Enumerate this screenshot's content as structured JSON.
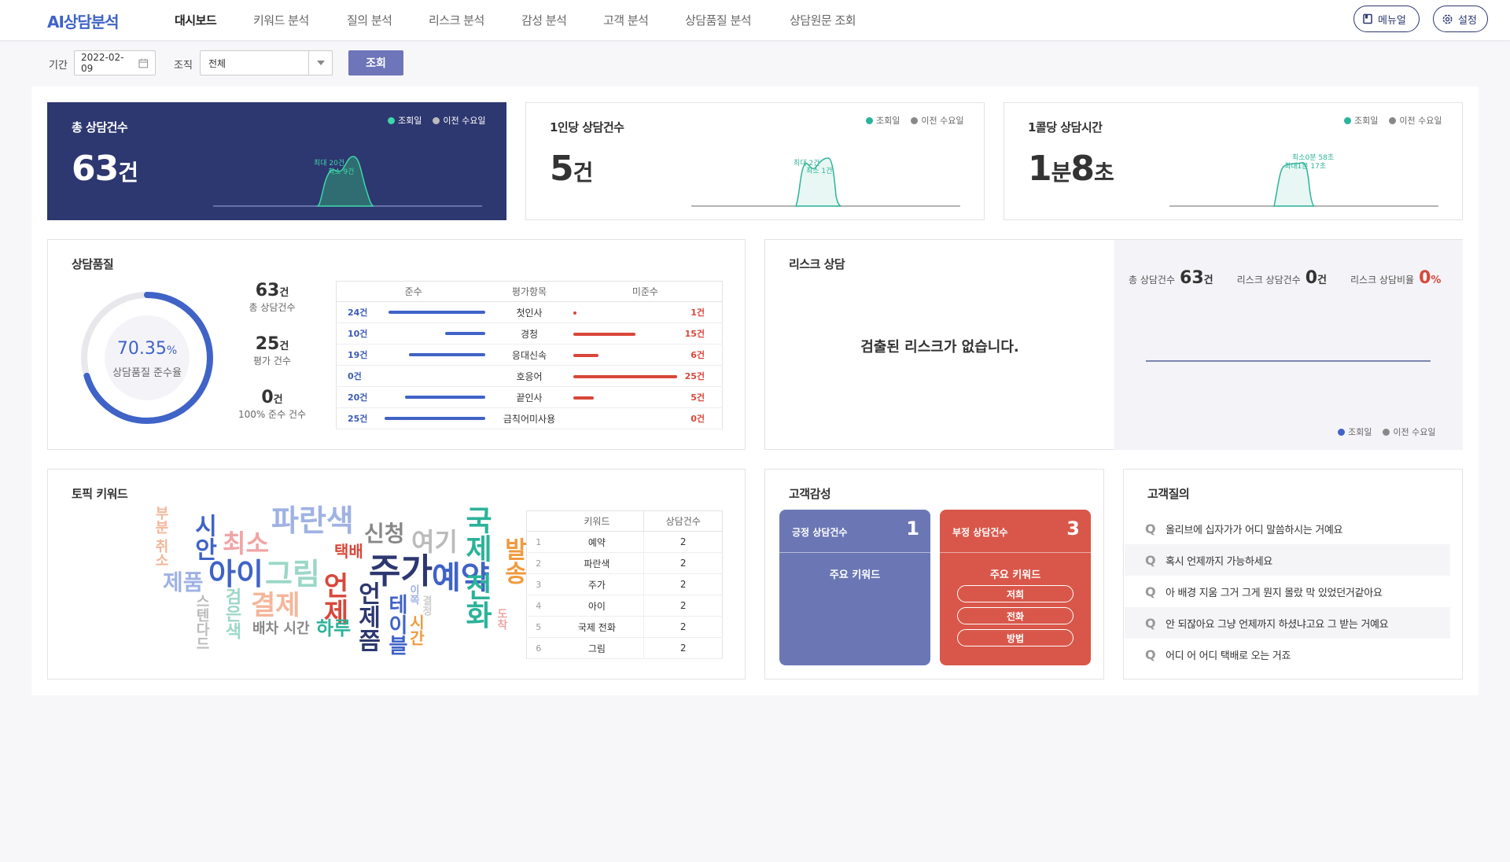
{
  "header": {
    "logo": "AI상담분석",
    "nav": [
      "대시보드",
      "키워드 분석",
      "질의 분석",
      "리스크 분석",
      "감성 분석",
      "고객 분석",
      "상담품질 분석",
      "상담원문 조회"
    ],
    "manual_label": "메뉴얼",
    "settings_label": "설정"
  },
  "filter": {
    "period_label": "기간",
    "date_value": "2022-02-09",
    "org_label": "조직",
    "org_value": "전체",
    "search_label": "조회"
  },
  "legend": {
    "today": "조회일",
    "prev": "이전 수요일"
  },
  "kpi": [
    {
      "title": "총 상담건수",
      "value": "63",
      "unit": "건",
      "peak_max": "최대 20건",
      "peak_min": "최소 9건"
    },
    {
      "title": "1인당 상담건수",
      "value": "5",
      "unit": "건",
      "peak_max": "최대 2건",
      "peak_min": "최소 1건"
    },
    {
      "title": "1콜당 상담시간",
      "value1": "1",
      "unit1": "분",
      "value2": "8",
      "unit2": "초",
      "peak_max": "최소0분 58초",
      "peak_min": "최대1분 17초"
    }
  ],
  "quality": {
    "title": "상담품질",
    "rate": "70.35",
    "rate_unit": "%",
    "rate_label": "상담품질 준수율",
    "rate_fraction": 0.7035,
    "stats": [
      {
        "value": "63",
        "unit": "건",
        "label": "총 상담건수"
      },
      {
        "value": "25",
        "unit": "건",
        "label": "평가 건수"
      },
      {
        "value": "0",
        "unit": "건",
        "label": "100% 준수 건수"
      }
    ],
    "headers": [
      "준수",
      "평가항목",
      "미준수"
    ],
    "rows": [
      {
        "ok": "24건",
        "ok_n": 24,
        "item": "첫인사",
        "ng": "1건",
        "ng_n": 1
      },
      {
        "ok": "10건",
        "ok_n": 10,
        "item": "경청",
        "ng": "15건",
        "ng_n": 15
      },
      {
        "ok": "19건",
        "ok_n": 19,
        "item": "응대신속",
        "ng": "6건",
        "ng_n": 6
      },
      {
        "ok": "0건",
        "ok_n": 0,
        "item": "호응어",
        "ng": "25건",
        "ng_n": 25
      },
      {
        "ok": "20건",
        "ok_n": 20,
        "item": "끝인사",
        "ng": "5건",
        "ng_n": 5
      },
      {
        "ok": "25건",
        "ok_n": 25,
        "item": "금칙어미사용",
        "ng": "0건",
        "ng_n": 0
      }
    ]
  },
  "risk": {
    "title": "리스크 상담",
    "empty_message": "검출된 리스크가 없습니다.",
    "stats": [
      {
        "label": "총 상담건수",
        "value": "63",
        "unit": "건"
      },
      {
        "label": "리스크 상담건수",
        "value": "0",
        "unit": "건"
      },
      {
        "label": "리스크 상담비율",
        "value": "0",
        "unit": "%"
      }
    ]
  },
  "topic": {
    "title": "토픽 키워드",
    "headers": [
      "키워드",
      "상담건수"
    ],
    "rows": [
      {
        "rank": "1",
        "keyword": "예약",
        "count": "2"
      },
      {
        "rank": "2",
        "keyword": "파란색",
        "count": "2"
      },
      {
        "rank": "3",
        "keyword": "주가",
        "count": "2"
      },
      {
        "rank": "4",
        "keyword": "아이",
        "count": "2"
      },
      {
        "rank": "5",
        "keyword": "국제 전화",
        "count": "2"
      },
      {
        "rank": "6",
        "keyword": "그림",
        "count": "2"
      }
    ],
    "cloud": [
      {
        "t": "파란색",
        "c": "#9fb2e3"
      },
      {
        "t": "신청",
        "c": "#888"
      },
      {
        "t": "여기",
        "c": "#bbb"
      },
      {
        "t": "시안",
        "c": "#3f63c7"
      },
      {
        "t": "최소",
        "c": "#f0a5a5"
      },
      {
        "t": "택배",
        "c": "#d9473a"
      },
      {
        "t": "아이",
        "c": "#3f63c7"
      },
      {
        "t": "그림",
        "c": "#9bd7c7"
      },
      {
        "t": "주가",
        "c": "#2d3770"
      },
      {
        "t": "예약",
        "c": "#3f63c7"
      },
      {
        "t": "국제 전화",
        "c": "#2bb39a"
      },
      {
        "t": "발송",
        "c": "#f09a3e"
      },
      {
        "t": "제품",
        "c": "#9fb2e3"
      },
      {
        "t": "결제",
        "c": "#f4b69a"
      },
      {
        "t": "언제",
        "c": "#d9473a"
      },
      {
        "t": "테이블",
        "c": "#3f63c7"
      },
      {
        "t": "언제쯤",
        "c": "#2d3770"
      },
      {
        "t": "하루",
        "c": "#2bb39a"
      },
      {
        "t": "배차 시간",
        "c": "#888"
      },
      {
        "t": "검은색",
        "c": "#9bd7c7"
      },
      {
        "t": "부분 취소",
        "c": "#f4b69a"
      },
      {
        "t": "스텐다드",
        "c": "#bbb"
      },
      {
        "t": "시간",
        "c": "#f09a3e"
      },
      {
        "t": "도착",
        "c": "#f0a5a5"
      },
      {
        "t": "이쪽",
        "c": "#9fb2e3"
      },
      {
        "t": "결정",
        "c": "#ccc"
      }
    ]
  },
  "sentiment": {
    "title": "고객감성",
    "pos_label": "긍정 상담건수",
    "pos_value": "1",
    "pos_kw_title": "주요 키워드",
    "neg_label": "부정 상담건수",
    "neg_value": "3",
    "neg_kw_title": "주요 키워드",
    "neg_keywords": [
      "저희",
      "전화",
      "방법"
    ]
  },
  "questions": {
    "title": "고객질의",
    "prefix": "Q",
    "items": [
      "올리브에 십자가가 어디 말씀하시는 거예요",
      "혹시 언제까지 가능하세요",
      "아 배경 지움 그거 그게 뭔지 몰랐 막 있었던거같아요",
      "안 되잖아요 그냥 언제까지 하셨냐고요 그 받는 거예요",
      "어디 어 어디 택배로 오는 거죠"
    ]
  },
  "colors": {
    "accent": "#3f63c7",
    "navy": "#2d3770",
    "teal": "#2bb39a",
    "red": "#d9473a",
    "positive": "#6b77b5",
    "negative": "#d9574a"
  }
}
